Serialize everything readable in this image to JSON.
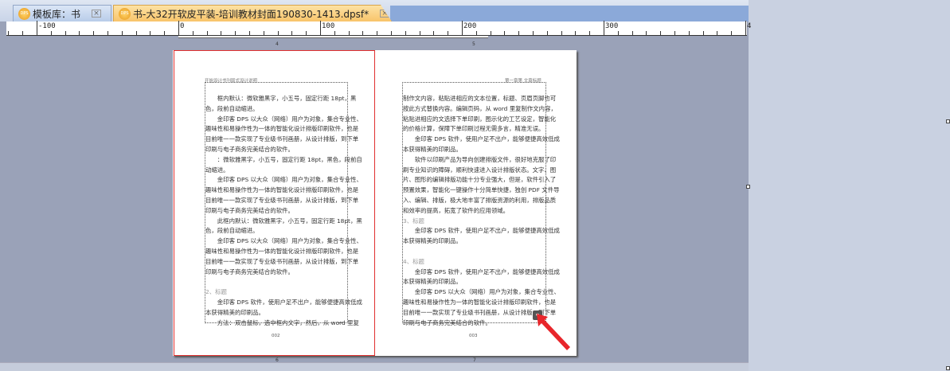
{
  "tabs": [
    {
      "label": "模板库：书",
      "icon": "dps-logo"
    },
    {
      "label": "书-大32开软皮平装-培训教材封面190830-1413.dpsf*",
      "icon": "dps-logo"
    }
  ],
  "ruler": {
    "labels": [
      "-100",
      "0",
      "100",
      "200",
      "300",
      "4"
    ]
  },
  "page_markers": {
    "top_left": "4",
    "top_right": "5",
    "bottom_left": "6",
    "bottom_right": "7"
  },
  "left_page": {
    "header": "开始设计书刊版式设计说明",
    "page_number": "002",
    "lines": [
      "　　框内默认：微软雅黑字，小五号，固定行距 18pt，黑",
      "色，段前自动缩进。",
      "　　金印客 DPS 以大众（网络）用户为对象，集合专业性、",
      "趣味性和易操作性为一体的智能化设计排版印刷软件，也是",
      "目前唯一一款实现了专业级书刊画册，从设计排版，到下单",
      "印刷与电子商务完美结合的软件。",
      "　　：微软雅黑字，小五号，固定行距 18pt，黑色，段前自",
      "动缩进。",
      "　　金印客 DPS 以大众（网络）用户为对象，集合专业性、",
      "趣味性和易操作性为一体的智能化设计排版印刷软件，也是",
      "目前唯一一款实现了专业级书刊画册，从设计排版，到下单",
      "印刷与电子商务完美结合的软件。",
      "　　此框内默认：微软雅黑字，小五号，固定行距 18pt，黑",
      "色，段前自动缩进。",
      "　　金印客 DPS 以大众（网络）用户为对象，集合专业性、",
      "趣味性和易操作性为一体的智能化设计排版印刷软件，也是",
      "目前唯一一款实现了专业级书刊画册，从设计排版，到下单",
      "印刷与电子商务完美结合的软件。",
      "",
      "2、标题",
      "　　金印客 DPS 软件，使用户足不出户，能够便捷高效低成",
      "本获得精美的印刷品。",
      "　　方法：双击鼠标，选中框内文字，然后，从 word 里复"
    ]
  },
  "right_page": {
    "header": "第一章第 文章标题",
    "page_number": "003",
    "lines": [
      "制作文内容，粘贴进相应的文本位置，标题、页眉页脚也可",
      "按此方式替换内容。编辑页码，从 word 里复制作文内容，",
      "粘贴进相应的文选择下单印刷，图示化的工艺设定，智能化",
      "的价格计算，保障下单印刷过程无需多言，精准无误。",
      "　　金印客 DPS 软件，使用户足不出户，能够便捷高效低成",
      "本获得精美的印刷品。",
      "　　软件以印刷产品为导向创建排版文件，很好地克服了印",
      "刷专业知识的障碍，顺利快速进入设计排版状态。文字、图",
      "片、图形的编辑排版功能十分专业强大，但是，软件引入了",
      "预置效果，智能化一键操作十分简单快捷，独创 PDF 文件导",
      "入、编辑、排版，极大地丰富了排版资源的利用，排版品质",
      "和效率的提高，拓宽了软件的应用领域。",
      "3、标题",
      "　　金印客 DPS 软件，使用户足不出户，能够便捷高效低成",
      "本获得精美的印刷品。",
      "",
      "4、标题",
      "　　金印客 DPS 软件，使用户足不出户，能够便捷高效低成",
      "本获得精美的印刷品。",
      "　　金印客 DPS 以大众（网络）用户为对象，集合专业性、",
      "趣味性和易操作性为一体的智能化设计排版印刷软件，也是",
      "目前唯一一款实现了专业级书刊画册，从设计排版，到下单",
      "印刷与电子商务完美结合的软件。"
    ]
  },
  "colors": {
    "selection": "#e03030",
    "arrow": "#e8262b"
  }
}
